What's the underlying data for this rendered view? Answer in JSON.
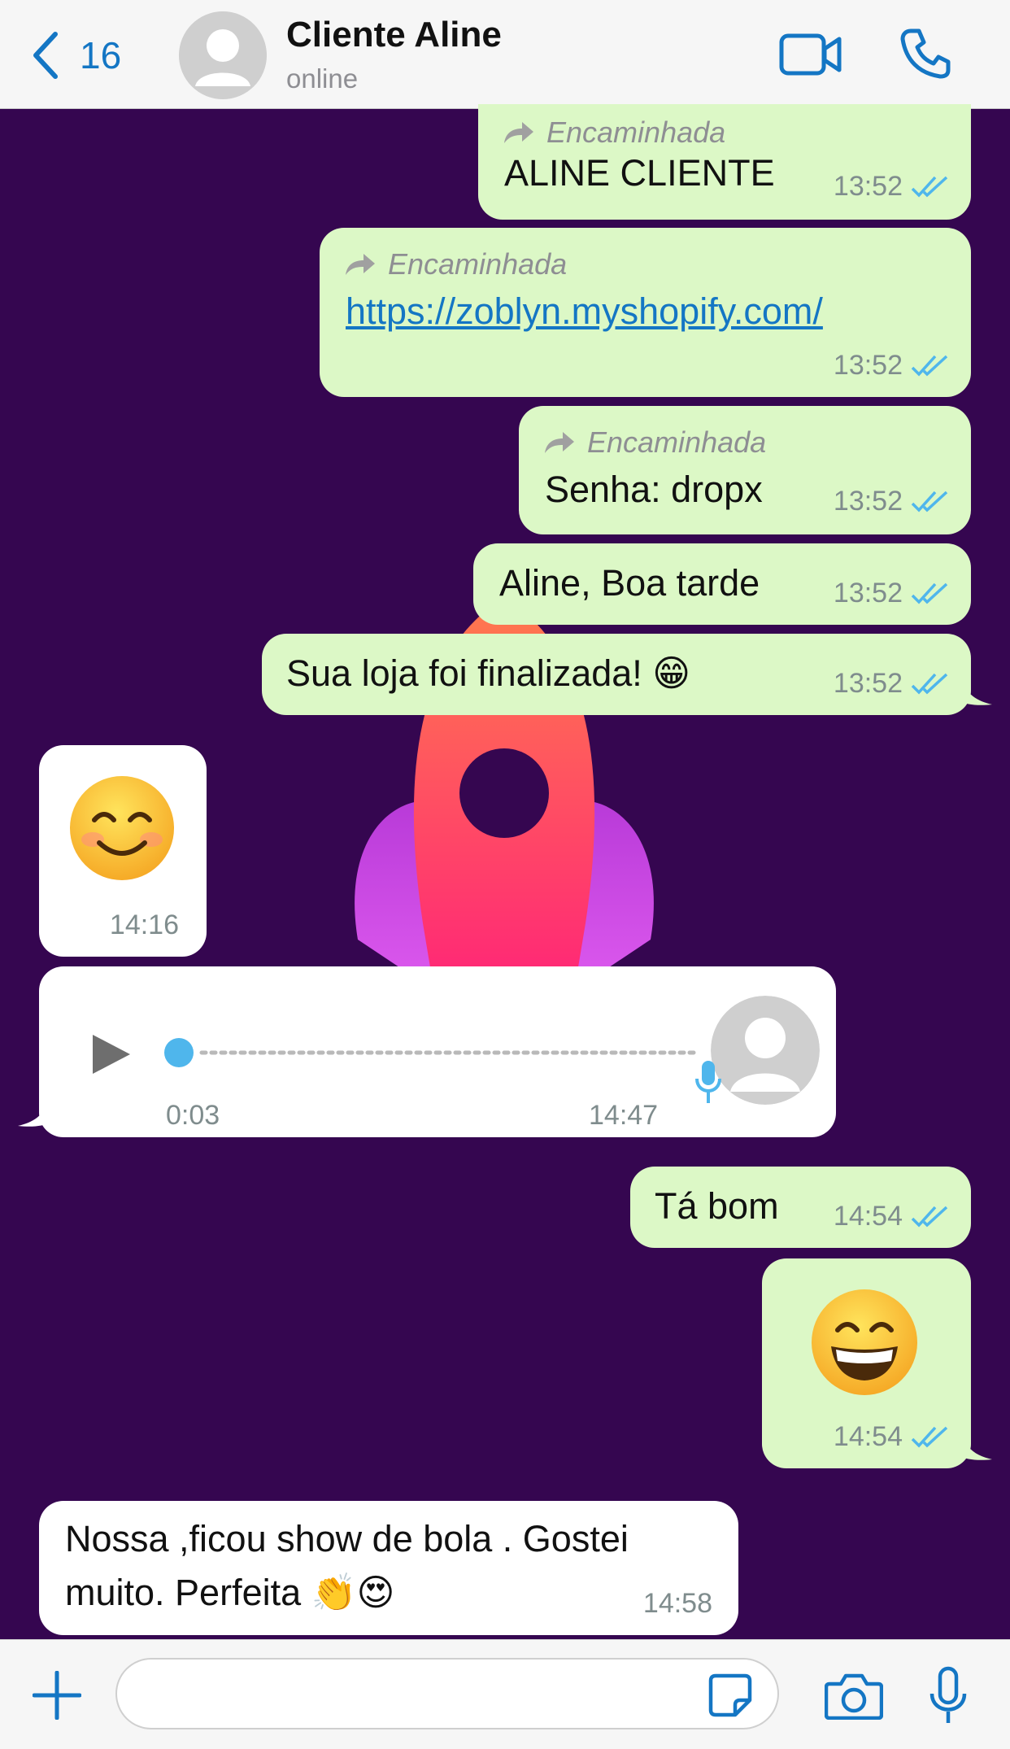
{
  "header": {
    "back_count": "16",
    "contact_name": "Cliente Aline",
    "contact_status": "online"
  },
  "colors": {
    "accent": "#1476c4",
    "chat_background": "#350650",
    "outgoing_bubble": "#dcf8c6",
    "incoming_bubble": "#ffffff",
    "read_ticks": "#4fb6ec"
  },
  "messages": [
    {
      "direction": "out",
      "forwarded_label": "Encaminhada",
      "text": "ALINE CLIENTE",
      "time": "13:52",
      "status": "read"
    },
    {
      "direction": "out",
      "forwarded_label": "Encaminhada",
      "text": "https://zoblyn.myshopify.com/",
      "time": "13:52",
      "status": "read"
    },
    {
      "direction": "out",
      "forwarded_label": "Encaminhada",
      "text": "Senha: dropx",
      "time": "13:52",
      "status": "read"
    },
    {
      "direction": "out",
      "text": "Aline, Boa tarde",
      "time": "13:52",
      "status": "read"
    },
    {
      "direction": "out",
      "text": "Sua loja foi finalizada! 😁",
      "time": "13:52",
      "status": "read"
    },
    {
      "direction": "in",
      "emoji": "smiling-face-with-smiling-eyes",
      "time": "14:16"
    },
    {
      "direction": "in",
      "type": "voice",
      "duration": "0:03",
      "time": "14:47"
    },
    {
      "direction": "out",
      "text": "Tá bom",
      "time": "14:54",
      "status": "read"
    },
    {
      "direction": "out",
      "emoji": "grinning-face-with-smiling-eyes",
      "time": "14:54",
      "status": "read"
    },
    {
      "direction": "in",
      "text_line1": "Nossa ,ficou show de bola . Gostei",
      "text_line2": "muito. Perfeita 👏😍",
      "time": "14:58"
    }
  ],
  "input": {
    "placeholder": ""
  }
}
